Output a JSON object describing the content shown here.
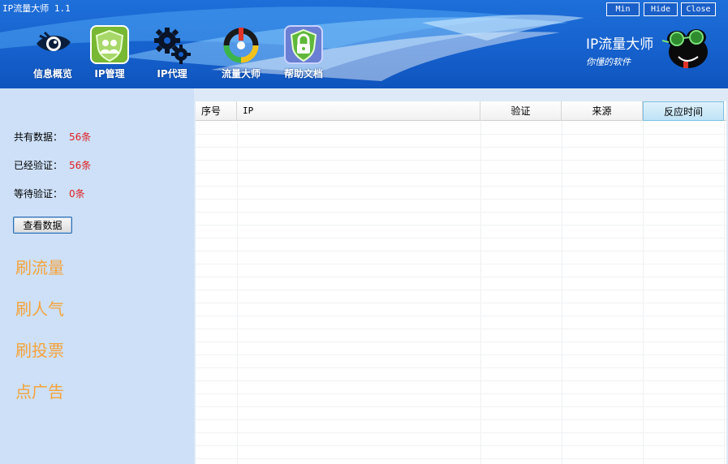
{
  "window": {
    "title": "IP流量大师 1.1",
    "buttons": {
      "min": "Min",
      "hide": "Hide",
      "close": "Close"
    }
  },
  "nav": {
    "items": [
      {
        "label": "信息概览",
        "icon": "eye-icon"
      },
      {
        "label": "IP管理",
        "icon": "users-shield-icon"
      },
      {
        "label": "IP代理",
        "icon": "gears-icon"
      },
      {
        "label": "流量大师",
        "icon": "traffic-wheel-icon"
      },
      {
        "label": "帮助文档",
        "icon": "lock-shield-icon"
      }
    ]
  },
  "brand": {
    "name": "IP流量大师",
    "slogan": "你懂的软件",
    "mascot_icon": "frog-sunglasses-icon"
  },
  "sidebar": {
    "stats": [
      {
        "label": "共有数据：",
        "value": "56条"
      },
      {
        "label": "已经验证：",
        "value": "56条"
      },
      {
        "label": "等待验证：",
        "value": "0条"
      }
    ],
    "view_button": "查看数据",
    "links": [
      "刷流量",
      "刷人气",
      "刷投票",
      "点广告"
    ]
  },
  "table": {
    "columns": [
      "序号",
      "IP",
      "验证",
      "来源",
      "反应时间"
    ],
    "selected_column": "反应时间",
    "rows": []
  },
  "colors": {
    "header_blue": "#1560cc",
    "sidebar_bg": "#cde0f7",
    "stat_value": "#e02020",
    "link_orange": "#f5a33a"
  }
}
